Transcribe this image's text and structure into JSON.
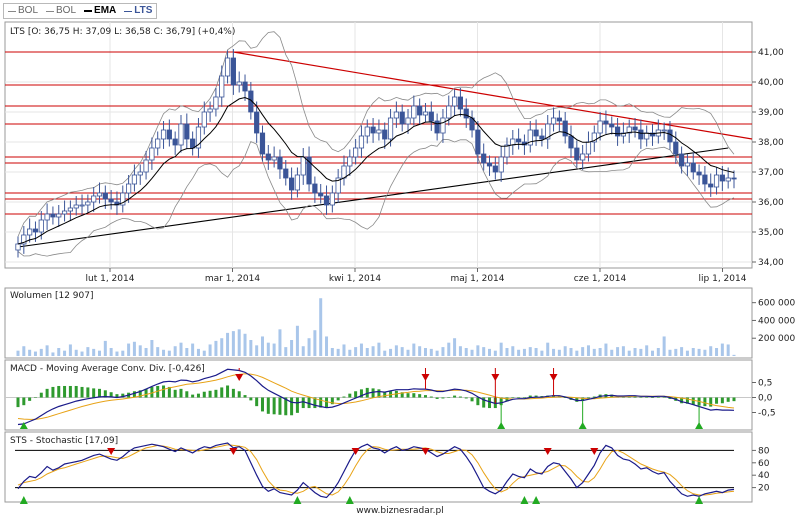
{
  "legend": {
    "items": [
      "BOL",
      "BOL",
      "EMA",
      "LTS"
    ],
    "active": "EMA"
  },
  "footer": "www.biznesradar.pl",
  "colors": {
    "price_bar": "#3b5598",
    "grid": "#e6e6e6",
    "support_line": "#cc0000",
    "trend_line": "#000000",
    "ema": "#000000",
    "bollinger": "#8a8a8a",
    "volume": "#a9c6ea",
    "macd_line": "#1b1b8a",
    "signal_line": "#e8a317",
    "histogram": "#2e9a2e",
    "buy_marker": "#22aa22",
    "sell_marker": "#cc0000",
    "stoch_k": "#1b1b8a",
    "stoch_d": "#e8a317"
  },
  "chart_data": [
    {
      "type": "candlestick",
      "title": "LTS [O: 36,75  H: 37,09  L: 36,58  C: 36,79]  (+0,4%)",
      "y_ticks": [
        "34,00",
        "35,00",
        "36,00",
        "37,00",
        "38,00",
        "39,00",
        "40,00",
        "41,00"
      ],
      "ylim": [
        34.0,
        41.4
      ],
      "x_ticks": [
        "lut 1, 2014",
        "mar 1, 2014",
        "kwi 1, 2014",
        "maj 1, 2014",
        "cze 1, 2014",
        "lip 1, 2014"
      ],
      "close": [
        34.6,
        34.9,
        35.1,
        35.0,
        35.4,
        35.6,
        35.5,
        35.6,
        35.7,
        35.8,
        35.9,
        35.9,
        36.0,
        36.2,
        36.3,
        36.1,
        36.0,
        35.9,
        36.3,
        36.6,
        36.9,
        37.0,
        37.4,
        37.8,
        38.1,
        38.4,
        38.1,
        37.9,
        38.6,
        38.1,
        37.8,
        38.5,
        39.0,
        39.1,
        39.5,
        40.2,
        40.8,
        39.9,
        40.0,
        39.7,
        39.0,
        38.3,
        37.6,
        37.4,
        37.5,
        37.1,
        36.8,
        36.4,
        36.9,
        37.5,
        36.6,
        36.3,
        36.2,
        35.9,
        36.3,
        36.8,
        37.2,
        37.5,
        37.8,
        38.2,
        38.5,
        38.3,
        38.4,
        38.1,
        38.8,
        39.0,
        38.6,
        38.8,
        39.2,
        38.9,
        39.0,
        38.7,
        38.3,
        38.8,
        39.2,
        39.5,
        39.1,
        38.8,
        38.4,
        37.6,
        37.3,
        37.2,
        37.0,
        37.5,
        37.9,
        38.1,
        38.0,
        37.9,
        38.4,
        38.2,
        38.1,
        38.6,
        38.8,
        38.7,
        38.2,
        37.8,
        37.4,
        37.6,
        38.0,
        38.3,
        38.7,
        38.6,
        38.5,
        38.2,
        38.3,
        38.5,
        38.4,
        38.1,
        38.3,
        38.2,
        38.4,
        38.4,
        38.0,
        37.6,
        37.2,
        37.3,
        37.0,
        36.9,
        36.6,
        36.5,
        36.9,
        36.7,
        36.8,
        36.79
      ],
      "horizontal_levels": [
        41.0,
        39.9,
        39.2,
        38.6,
        37.5,
        37.3,
        36.3,
        36.1,
        35.6
      ],
      "resistance_line": [
        [
          37,
          41.0
        ],
        [
          130,
          38.1
        ]
      ],
      "support_line": [
        [
          0,
          34.5
        ],
        [
          122,
          37.8
        ]
      ],
      "series": [
        {
          "name": "EMA"
        },
        {
          "name": "BOL"
        },
        {
          "name": "BOL"
        }
      ]
    },
    {
      "type": "bar",
      "title": "Wolumen [12 907]",
      "y_ticks": [
        "200 000",
        "400 000",
        "600 000"
      ],
      "ylim": [
        0,
        720000
      ],
      "values": [
        60000,
        110000,
        70000,
        50000,
        80000,
        120000,
        40000,
        90000,
        60000,
        130000,
        70000,
        50000,
        100000,
        80000,
        60000,
        170000,
        90000,
        50000,
        60000,
        140000,
        160000,
        120000,
        90000,
        180000,
        100000,
        70000,
        60000,
        110000,
        150000,
        90000,
        140000,
        80000,
        60000,
        130000,
        170000,
        200000,
        260000,
        280000,
        300000,
        250000,
        180000,
        120000,
        220000,
        150000,
        140000,
        300000,
        100000,
        180000,
        340000,
        110000,
        200000,
        290000,
        650000,
        220000,
        90000,
        80000,
        130000,
        70000,
        100000,
        140000,
        90000,
        110000,
        150000,
        60000,
        80000,
        120000,
        100000,
        70000,
        140000,
        110000,
        90000,
        80000,
        60000,
        100000,
        150000,
        200000,
        110000,
        90000,
        70000,
        120000,
        100000,
        80000,
        60000,
        150000,
        90000,
        110000,
        70000,
        80000,
        100000,
        90000,
        60000,
        150000,
        80000,
        70000,
        110000,
        90000,
        60000,
        100000,
        120000,
        80000,
        90000,
        140000,
        70000,
        100000,
        110000,
        60000,
        90000,
        80000,
        120000,
        60000,
        90000,
        220000,
        70000,
        80000,
        100000,
        60000,
        90000,
        80000,
        70000,
        110000,
        90000,
        140000,
        130000,
        12907
      ]
    },
    {
      "type": "line",
      "title": "MACD - Moving Average Conv. Div. [-0,426]",
      "y_ticks": [
        "-0,5",
        "0,0",
        "0,5"
      ],
      "ylim": [
        -0.95,
        1.05
      ],
      "series": [
        {
          "name": "MACD",
          "values": [
            -0.9,
            -0.88,
            -0.8,
            -0.72,
            -0.6,
            -0.48,
            -0.38,
            -0.3,
            -0.24,
            -0.18,
            -0.12,
            -0.08,
            -0.04,
            -0.01,
            0.02,
            0.03,
            0.02,
            0.0,
            0.03,
            0.08,
            0.14,
            0.2,
            0.28,
            0.37,
            0.45,
            0.52,
            0.54,
            0.52,
            0.58,
            0.57,
            0.52,
            0.56,
            0.63,
            0.68,
            0.74,
            0.84,
            0.94,
            0.92,
            0.9,
            0.84,
            0.72,
            0.56,
            0.38,
            0.24,
            0.14,
            0.04,
            -0.06,
            -0.16,
            -0.18,
            -0.14,
            -0.2,
            -0.26,
            -0.3,
            -0.34,
            -0.32,
            -0.26,
            -0.18,
            -0.1,
            -0.02,
            0.06,
            0.14,
            0.18,
            0.2,
            0.18,
            0.22,
            0.26,
            0.26,
            0.26,
            0.29,
            0.28,
            0.28,
            0.25,
            0.2,
            0.2,
            0.24,
            0.28,
            0.26,
            0.22,
            0.14,
            0.02,
            -0.08,
            -0.14,
            -0.2,
            -0.18,
            -0.12,
            -0.06,
            -0.04,
            -0.04,
            0.0,
            0.01,
            0.01,
            0.04,
            0.06,
            0.06,
            0.02,
            -0.04,
            -0.1,
            -0.1,
            -0.06,
            -0.02,
            0.04,
            0.06,
            0.07,
            0.05,
            0.05,
            0.06,
            0.06,
            0.04,
            0.04,
            0.03,
            0.04,
            0.04,
            0.0,
            -0.06,
            -0.14,
            -0.18,
            -0.24,
            -0.3,
            -0.36,
            -0.42,
            -0.4,
            -0.42,
            -0.42,
            -0.426
          ]
        },
        {
          "name": "Signal",
          "values": [
            -0.7,
            -0.72,
            -0.73,
            -0.73,
            -0.7,
            -0.66,
            -0.6,
            -0.54,
            -0.48,
            -0.42,
            -0.36,
            -0.3,
            -0.25,
            -0.2,
            -0.16,
            -0.12,
            -0.09,
            -0.07,
            -0.05,
            -0.02,
            0.01,
            0.05,
            0.1,
            0.15,
            0.21,
            0.27,
            0.32,
            0.36,
            0.4,
            0.44,
            0.46,
            0.48,
            0.51,
            0.54,
            0.58,
            0.63,
            0.69,
            0.74,
            0.77,
            0.79,
            0.78,
            0.74,
            0.67,
            0.58,
            0.49,
            0.4,
            0.31,
            0.21,
            0.14,
            0.08,
            0.02,
            -0.04,
            -0.09,
            -0.14,
            -0.18,
            -0.2,
            -0.2,
            -0.18,
            -0.15,
            -0.11,
            -0.06,
            -0.01,
            0.03,
            0.06,
            0.09,
            0.12,
            0.15,
            0.17,
            0.2,
            0.21,
            0.23,
            0.23,
            0.23,
            0.22,
            0.23,
            0.24,
            0.24,
            0.24,
            0.22,
            0.18,
            0.13,
            0.08,
            0.02,
            -0.02,
            -0.04,
            -0.05,
            -0.05,
            -0.05,
            -0.04,
            -0.03,
            -0.02,
            0.0,
            0.01,
            0.02,
            0.02,
            0.01,
            -0.01,
            -0.03,
            -0.04,
            -0.04,
            -0.02,
            -0.01,
            0.01,
            0.02,
            0.03,
            0.03,
            0.04,
            0.04,
            0.04,
            0.04,
            0.04,
            0.04,
            0.03,
            0.01,
            -0.02,
            -0.05,
            -0.09,
            -0.13,
            -0.18,
            -0.23,
            -0.27,
            -0.3,
            -0.33,
            -0.35
          ]
        }
      ],
      "buy_signals": [
        1,
        83,
        97,
        117
      ],
      "sell_signals": [
        38,
        70,
        82,
        92
      ]
    },
    {
      "type": "line",
      "title": "STS - Stochastic [17,09]",
      "y_ticks": [
        "20",
        "40",
        "60",
        "80"
      ],
      "ylim": [
        0,
        100
      ],
      "series": [
        {
          "name": "%K",
          "values": [
            18,
            30,
            38,
            36,
            44,
            54,
            48,
            52,
            58,
            60,
            62,
            64,
            68,
            72,
            74,
            70,
            66,
            64,
            70,
            78,
            84,
            86,
            88,
            90,
            88,
            86,
            82,
            78,
            84,
            80,
            76,
            82,
            86,
            84,
            88,
            90,
            92,
            84,
            86,
            80,
            60,
            40,
            22,
            14,
            18,
            12,
            10,
            8,
            16,
            28,
            20,
            12,
            6,
            4,
            14,
            28,
            46,
            64,
            80,
            86,
            90,
            84,
            82,
            76,
            82,
            86,
            80,
            82,
            86,
            84,
            82,
            76,
            70,
            74,
            80,
            86,
            82,
            70,
            56,
            38,
            20,
            14,
            10,
            16,
            30,
            42,
            38,
            36,
            50,
            44,
            42,
            54,
            60,
            58,
            46,
            34,
            20,
            28,
            42,
            56,
            76,
            88,
            84,
            72,
            66,
            64,
            58,
            50,
            52,
            46,
            42,
            44,
            30,
            20,
            10,
            6,
            8,
            6,
            10,
            12,
            14,
            12,
            16,
            17.09
          ]
        },
        {
          "name": "%D",
          "values": [
            24,
            28,
            30,
            32,
            36,
            42,
            46,
            50,
            52,
            55,
            58,
            61,
            64,
            67,
            70,
            71,
            70,
            68,
            67,
            70,
            75,
            80,
            84,
            86,
            88,
            87,
            85,
            82,
            81,
            81,
            80,
            79,
            81,
            83,
            85,
            87,
            89,
            88,
            87,
            85,
            78,
            65,
            47,
            31,
            21,
            16,
            15,
            12,
            11,
            14,
            20,
            22,
            16,
            10,
            8,
            13,
            24,
            38,
            55,
            70,
            81,
            86,
            85,
            82,
            80,
            81,
            82,
            82,
            82,
            83,
            84,
            82,
            78,
            75,
            75,
            78,
            81,
            80,
            73,
            60,
            44,
            30,
            18,
            13,
            17,
            27,
            35,
            38,
            40,
            42,
            44,
            46,
            51,
            56,
            55,
            48,
            38,
            30,
            29,
            36,
            50,
            66,
            78,
            80,
            76,
            70,
            64,
            58,
            54,
            50,
            47,
            45,
            41,
            33,
            23,
            15,
            10,
            8,
            8,
            9,
            11,
            12,
            13,
            14
          ]
        }
      ],
      "buy_signals": [
        1,
        48,
        57,
        87,
        89,
        117
      ],
      "sell_signals": [
        16,
        37,
        58,
        70,
        91,
        99
      ]
    }
  ]
}
